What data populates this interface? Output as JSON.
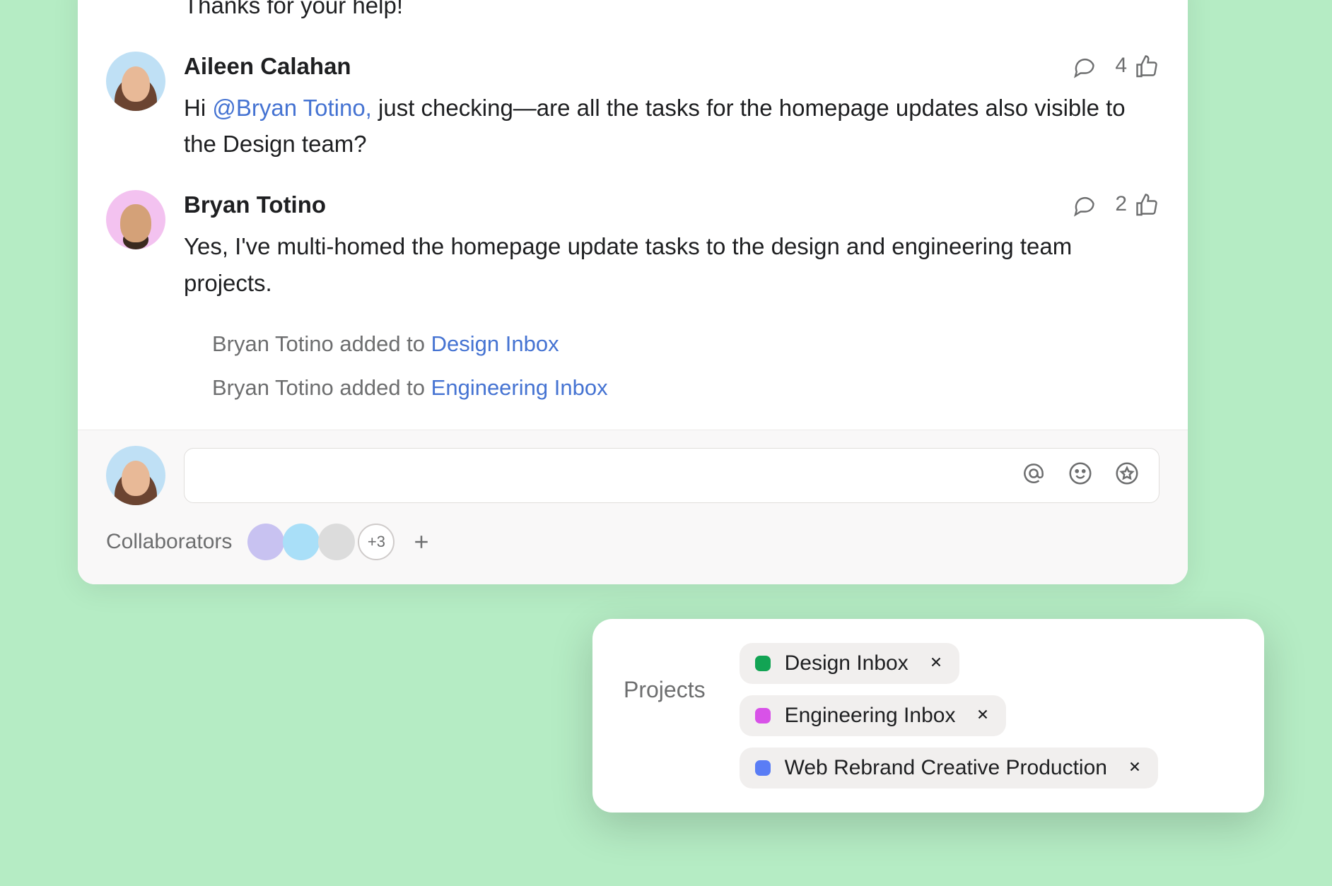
{
  "thread": {
    "partial_comment_text": "Thanks for your help!",
    "comments": [
      {
        "author": "Aileen Calahan",
        "text_before_mention": "Hi ",
        "mention": "@Bryan Totino,",
        "text_after_mention": "  just checking—are all the tasks for the homepage updates also visible to the Design team?",
        "like_count": "4"
      },
      {
        "author": "Bryan Totino",
        "text": "Yes, I've multi-homed the homepage update tasks to the design and engineering team projects.",
        "like_count": "2"
      }
    ],
    "activity": [
      {
        "actor_phrase": "Bryan Totino added to ",
        "link": "Design Inbox"
      },
      {
        "actor_phrase": "Bryan Totino added to ",
        "link": "Engineering Inbox"
      }
    ]
  },
  "collaborators": {
    "label": "Collaborators",
    "more_label": "+3"
  },
  "projects_popover": {
    "label": "Projects",
    "items": [
      {
        "name": "Design Inbox",
        "color": "#12a454"
      },
      {
        "name": "Engineering Inbox",
        "color": "#d852e8"
      },
      {
        "name": "Web Rebrand Creative Production",
        "color": "#5a7df5"
      }
    ]
  }
}
